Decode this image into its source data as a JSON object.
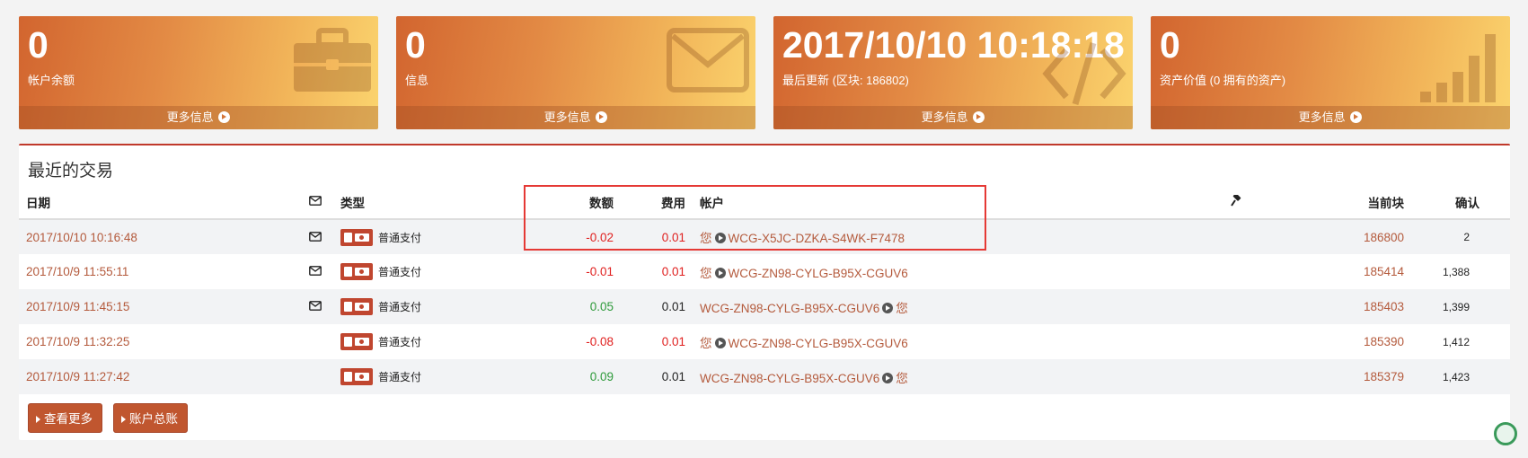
{
  "cards": [
    {
      "value": "0",
      "label": "帐户余额",
      "more": "更多信息",
      "icon": "briefcase-icon"
    },
    {
      "value": "0",
      "label": "信息",
      "more": "更多信息",
      "icon": "envelope-icon"
    },
    {
      "value": "2017/10/10 10:18:18",
      "label": "最后更新 (区块: 186802)",
      "more": "更多信息",
      "icon": "code-icon"
    },
    {
      "value": "0",
      "label": "资产价值 (0 拥有的资产)",
      "more": "更多信息",
      "icon": "signal-bars-icon"
    }
  ],
  "transactions": {
    "title": "最近的交易",
    "headers": {
      "date": "日期",
      "type": "类型",
      "amount": "数额",
      "fee": "费用",
      "account": "帐户",
      "block": "当前块",
      "confirm": "确认"
    },
    "rows": [
      {
        "date": "2017/10/10 10:16:48",
        "has_msg": true,
        "type": "普通支付",
        "amount": "-0.02",
        "fee": "0.01",
        "you": "您",
        "account": "WCG-X5JC-DZKA-S4WK-F7478",
        "direction": "out",
        "block": "186800",
        "confirm": "2"
      },
      {
        "date": "2017/10/9 11:55:11",
        "has_msg": true,
        "type": "普通支付",
        "amount": "-0.01",
        "fee": "0.01",
        "you": "您",
        "account": "WCG-ZN98-CYLG-B95X-CGUV6",
        "direction": "out",
        "block": "185414",
        "confirm": "1,388"
      },
      {
        "date": "2017/10/9 11:45:15",
        "has_msg": true,
        "type": "普通支付",
        "amount": "0.05",
        "fee": "0.01",
        "you": "您",
        "account": "WCG-ZN98-CYLG-B95X-CGUV6",
        "direction": "in",
        "block": "185403",
        "confirm": "1,399"
      },
      {
        "date": "2017/10/9 11:32:25",
        "has_msg": false,
        "type": "普通支付",
        "amount": "-0.08",
        "fee": "0.01",
        "you": "您",
        "account": "WCG-ZN98-CYLG-B95X-CGUV6",
        "direction": "out",
        "block": "185390",
        "confirm": "1,412"
      },
      {
        "date": "2017/10/9 11:27:42",
        "has_msg": false,
        "type": "普通支付",
        "amount": "0.09",
        "fee": "0.01",
        "you": "您",
        "account": "WCG-ZN98-CYLG-B95X-CGUV6",
        "direction": "in",
        "block": "185379",
        "confirm": "1,423"
      }
    ]
  },
  "buttons": {
    "view_more": "查看更多",
    "ledger": "账户总账"
  },
  "colors": {
    "accent": "#c0562f",
    "negative": "#e0201f",
    "positive": "#2e9a3a",
    "link": "#b45a3c",
    "highlight_box": "#e53935"
  }
}
